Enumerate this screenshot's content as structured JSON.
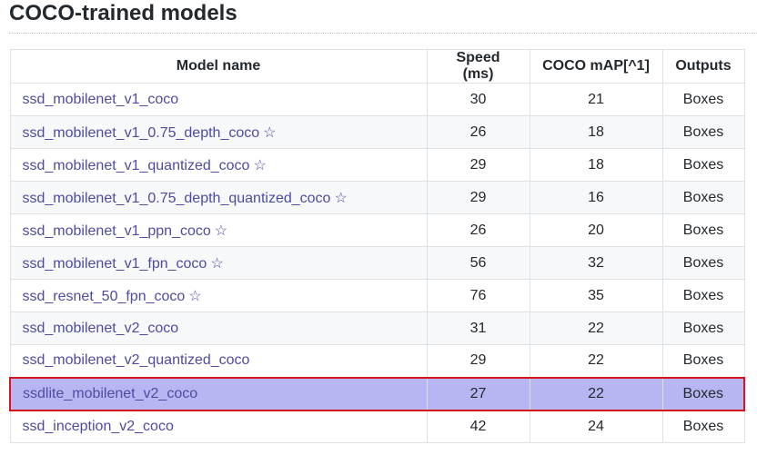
{
  "page": {
    "heading": "COCO-trained models"
  },
  "table": {
    "headers": [
      "Model name",
      "Speed (ms)",
      "COCO mAP[^1]",
      "Outputs"
    ],
    "rows": [
      {
        "name": "ssd_mobilenet_v1_coco",
        "star": "",
        "speed": "30",
        "map": "21",
        "outputs": "Boxes"
      },
      {
        "name": "ssd_mobilenet_v1_0.75_depth_coco",
        "star": "☆",
        "speed": "26",
        "map": "18",
        "outputs": "Boxes"
      },
      {
        "name": "ssd_mobilenet_v1_quantized_coco",
        "star": "☆",
        "speed": "29",
        "map": "18",
        "outputs": "Boxes"
      },
      {
        "name": "ssd_mobilenet_v1_0.75_depth_quantized_coco",
        "star": "☆",
        "speed": "29",
        "map": "16",
        "outputs": "Boxes"
      },
      {
        "name": "ssd_mobilenet_v1_ppn_coco",
        "star": "☆",
        "speed": "26",
        "map": "20",
        "outputs": "Boxes"
      },
      {
        "name": "ssd_mobilenet_v1_fpn_coco",
        "star": "☆",
        "speed": "56",
        "map": "32",
        "outputs": "Boxes"
      },
      {
        "name": "ssd_resnet_50_fpn_coco",
        "star": "☆",
        "speed": "76",
        "map": "35",
        "outputs": "Boxes"
      },
      {
        "name": "ssd_mobilenet_v2_coco",
        "star": "",
        "speed": "31",
        "map": "22",
        "outputs": "Boxes"
      },
      {
        "name": "ssd_mobilenet_v2_quantized_coco",
        "star": "",
        "speed": "29",
        "map": "22",
        "outputs": "Boxes"
      },
      {
        "name": "ssdlite_mobilenet_v2_coco",
        "star": "",
        "speed": "27",
        "map": "22",
        "outputs": "Boxes"
      },
      {
        "name": "ssd_inception_v2_coco",
        "star": "",
        "speed": "42",
        "map": "24",
        "outputs": "Boxes"
      }
    ],
    "highlighted_row_index": 9
  },
  "colors": {
    "link": "#4f4ba0",
    "highlight_fill": "#b8b6f2",
    "highlight_border": "#d6141c"
  }
}
